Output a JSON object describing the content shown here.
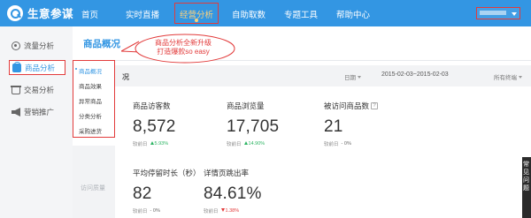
{
  "topbar": {
    "logo": "生意参谋",
    "nav": [
      {
        "label": "首页"
      },
      {
        "label": "实时直播"
      },
      {
        "label": "经营分析"
      },
      {
        "label": "自助取数"
      },
      {
        "label": "专题工具"
      },
      {
        "label": "帮助中心"
      }
    ],
    "active_nav": "经营分析"
  },
  "sidebar": {
    "items": [
      {
        "label": "流量分析",
        "icon": "eye-icon"
      },
      {
        "label": "商品分析",
        "icon": "bag-icon",
        "active": true
      },
      {
        "label": "交易分析",
        "icon": "cart-icon"
      },
      {
        "label": "营销推广",
        "icon": "megaphone-icon"
      }
    ],
    "submenu": [
      {
        "label": "商品概况",
        "active": true
      },
      {
        "label": "商品效果"
      },
      {
        "label": "异常商品"
      },
      {
        "label": "分类分析"
      },
      {
        "label": "采购进货"
      }
    ]
  },
  "main": {
    "title": "商品概况",
    "filter_heading": "况",
    "filter": {
      "date_label": "日期",
      "date_range": "2015-02-03~2015-02-03",
      "terminal_label": "所有终端"
    },
    "section_label": "访问质量",
    "compare_label": "较前日",
    "metrics": [
      {
        "title": "商品访客数",
        "value": "8,572",
        "delta": "5.93%",
        "trend": "up"
      },
      {
        "title": "商品浏览量",
        "value": "17,705",
        "delta": "14.90%",
        "trend": "up"
      },
      {
        "title": "被访问商品数",
        "value": "21",
        "delta": "0%",
        "trend": "flat",
        "help": "?"
      },
      {
        "title": "平均停留时长（秒）",
        "value": "82",
        "delta": "0%",
        "trend": "flat"
      },
      {
        "title": "详情页跳出率",
        "value": "84.61%",
        "delta": "1.38%",
        "trend": "down"
      }
    ]
  },
  "annotation": {
    "line1": "商品分析全新升级",
    "line2": "打造爆款so easy",
    "color": "#e23b3b"
  },
  "edge_panel": {
    "text": "常见问题"
  },
  "colors": {
    "brand": "#3396e3",
    "highlight": "#e23b3b",
    "up": "#2db463",
    "down": "#e23b3b"
  }
}
